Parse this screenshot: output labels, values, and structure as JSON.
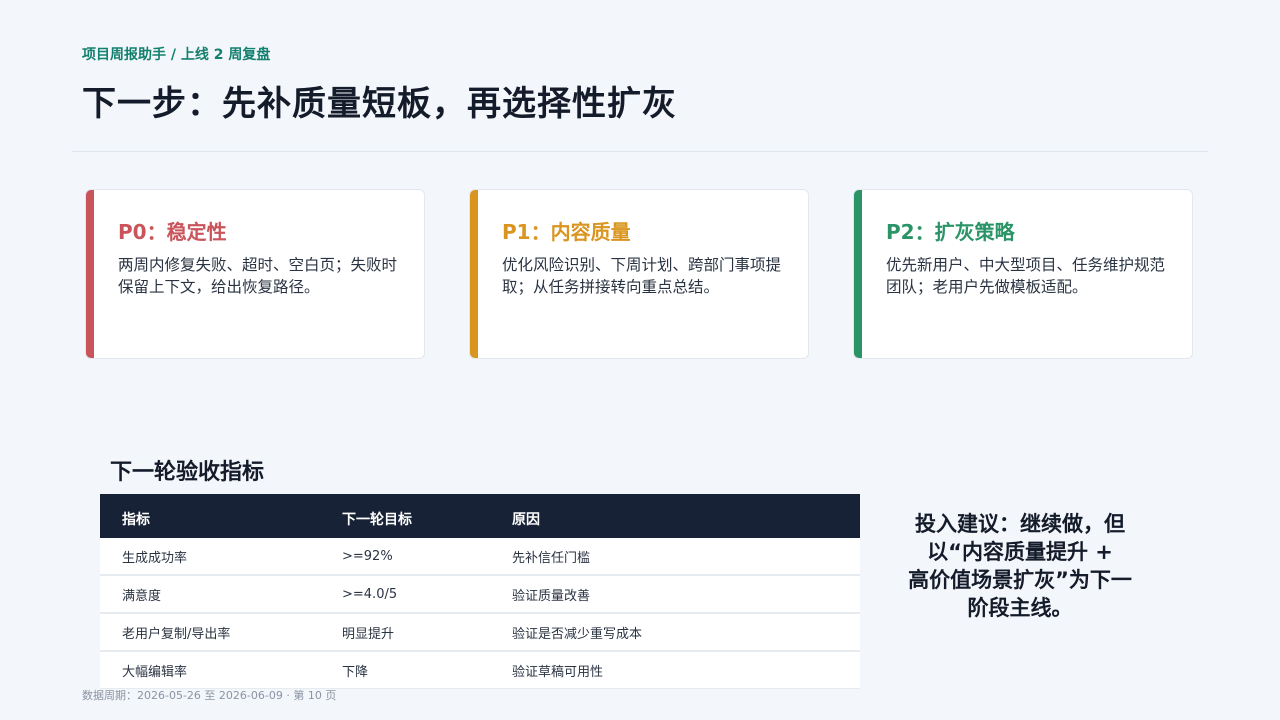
{
  "header": {
    "breadcrumb": "项目周报助手 / 上线 2 周复盘",
    "title": "下一步：先补质量短板，再选择性扩灰"
  },
  "cards": [
    {
      "title": "P0：稳定性",
      "body": "两周内修复失败、超时、空白页；失败时保留上下文，给出恢复路径。",
      "accent": "#c9545a"
    },
    {
      "title": "P1：内容质量",
      "body": "优化风险识别、下周计划、跨部门事项提取；从任务拼接转向重点总结。",
      "accent": "#d9951f"
    },
    {
      "title": "P2：扩灰策略",
      "body": "优先新用户、中大型项目、任务维护规范团队；老用户先做模板适配。",
      "accent": "#2a9467"
    }
  ],
  "metrics": {
    "section_title": "下一轮验收指标",
    "headers": [
      "指标",
      "下一轮目标",
      "原因"
    ],
    "rows": [
      [
        "生成成功率",
        ">=92%",
        "先补信任门槛"
      ],
      [
        "满意度",
        ">=4.0/5",
        "验证质量改善"
      ],
      [
        "老用户复制/导出率",
        "明显提升",
        "验证是否减少重写成本"
      ],
      [
        "大幅编辑率",
        "下降",
        "验证草稿可用性"
      ]
    ]
  },
  "advice": {
    "lines": [
      "投入建议：继续做，但",
      "以“内容质量提升 +",
      "高价值场景扩灰”为下一",
      "阶段主线。"
    ]
  },
  "footer": {
    "text": "数据周期：2026-05-26 至 2026-06-09 · 第 10 页"
  },
  "colors": {
    "accent_teal": "#14806f",
    "table_header": "#172236"
  }
}
